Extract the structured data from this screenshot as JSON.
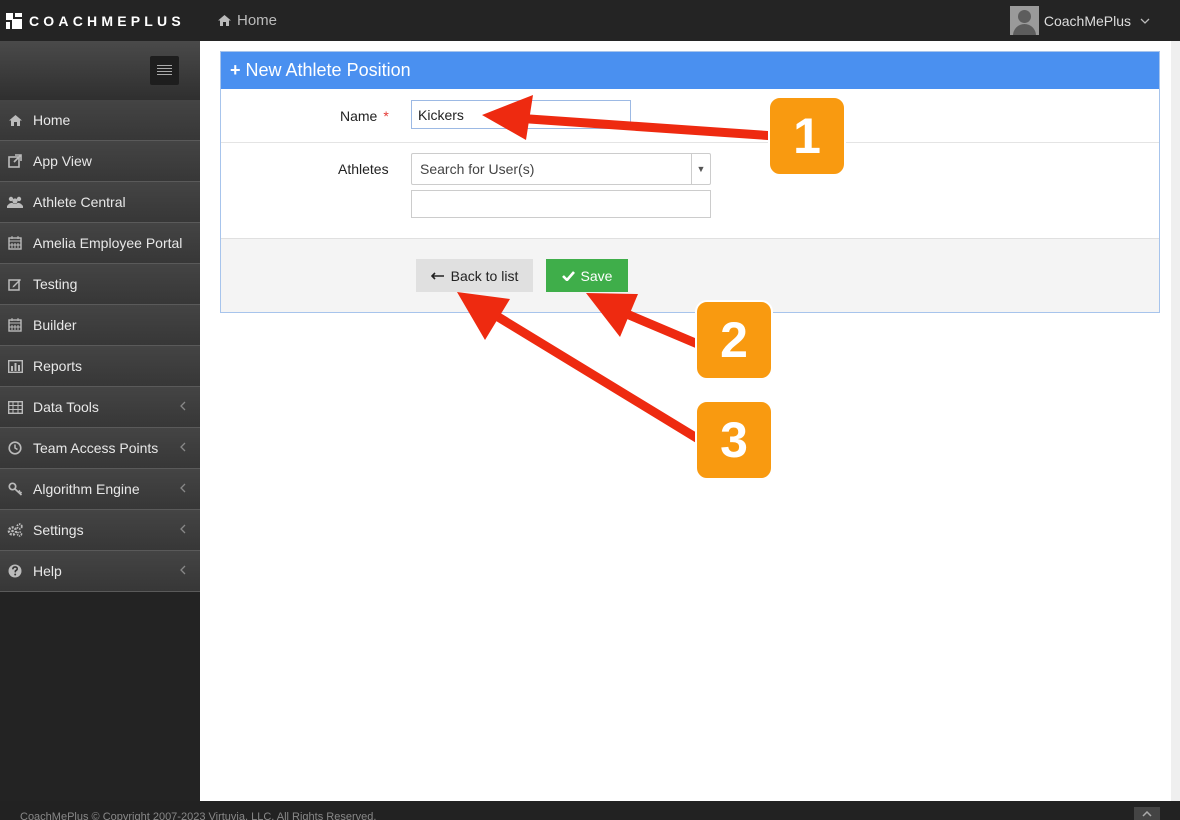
{
  "topbar": {
    "logo_text": "COACHMEPLUS",
    "home_label": "Home",
    "user_name": "CoachMePlus"
  },
  "sidebar": {
    "items": [
      {
        "label": "Home",
        "icon": "home-icon"
      },
      {
        "label": "App View",
        "icon": "external-link-icon"
      },
      {
        "label": "Athlete Central",
        "icon": "users-icon"
      },
      {
        "label": "Amelia Employee Portal",
        "icon": "calendar-icon"
      },
      {
        "label": "Testing",
        "icon": "edit-icon"
      },
      {
        "label": "Builder",
        "icon": "calendar-icon"
      },
      {
        "label": "Reports",
        "icon": "bar-chart-icon"
      },
      {
        "label": "Data Tools",
        "icon": "table-icon"
      },
      {
        "label": "Team Access Points",
        "icon": "clock-icon"
      },
      {
        "label": "Algorithm Engine",
        "icon": "key-icon"
      },
      {
        "label": "Settings",
        "icon": "gears-icon"
      },
      {
        "label": "Help",
        "icon": "question-circle-icon"
      }
    ]
  },
  "form": {
    "title": "New Athlete Position",
    "name_label": "Name",
    "required_marker": "*",
    "name_value": "Kickers",
    "athletes_label": "Athletes",
    "athletes_placeholder": "Search for User(s)",
    "back_label": "Back to list",
    "save_label": "Save"
  },
  "footer": {
    "copyright": "CoachMePlus © Copyright 2007-2023 Virtuvia, LLC. All Rights Reserved."
  },
  "annotations": {
    "badges": [
      "1",
      "2",
      "3"
    ],
    "color": "#f99a10",
    "arrow_color": "#ee2a10"
  }
}
